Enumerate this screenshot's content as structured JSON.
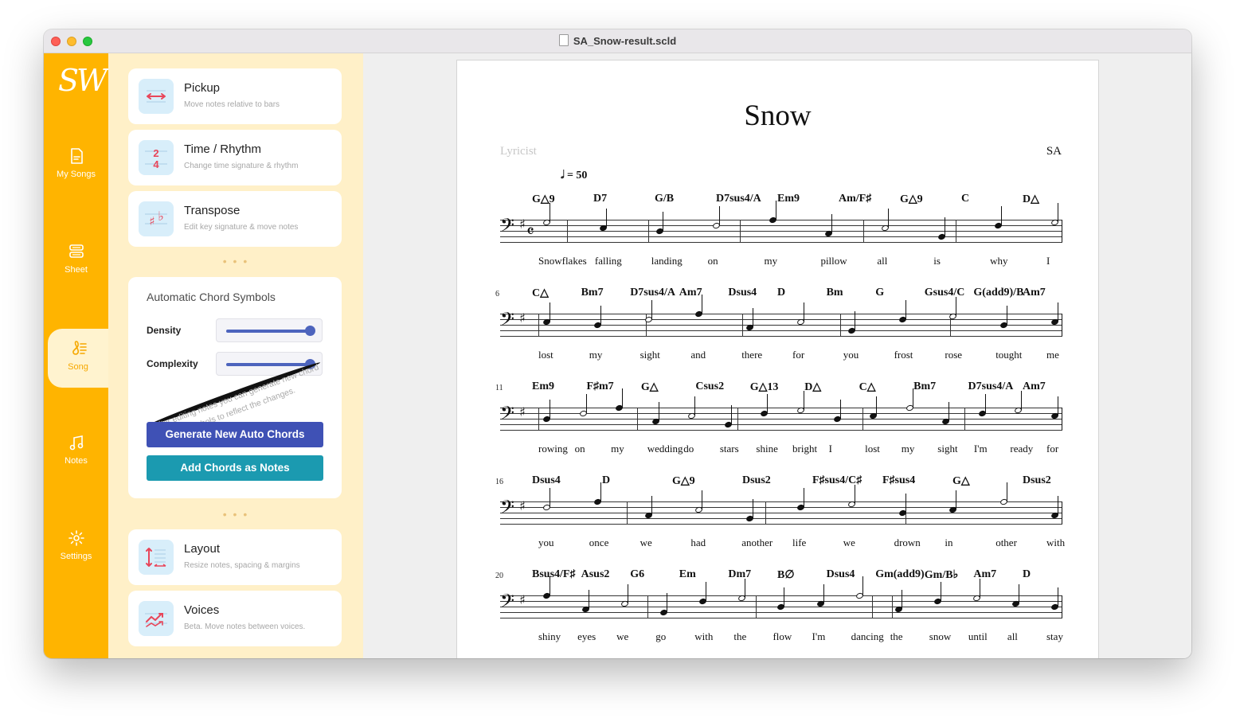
{
  "window": {
    "title": "SA_Snow-result.scld"
  },
  "nav": {
    "logo": "SW",
    "items": [
      {
        "label": "My Songs",
        "icon": "document-icon"
      },
      {
        "label": "Sheet",
        "icon": "sheet-icon"
      },
      {
        "label": "Song",
        "icon": "song-icon",
        "active": true
      },
      {
        "label": "Notes",
        "icon": "music-note-icon"
      },
      {
        "label": "Settings",
        "icon": "gear-icon"
      }
    ]
  },
  "panel": {
    "cards_top": [
      {
        "title": "Pickup",
        "subtitle": "Move notes relative to bars",
        "icon": "pickup-icon"
      },
      {
        "title": "Time / Rhythm",
        "subtitle": "Change time signature & rhythm",
        "icon": "time-signature-icon"
      },
      {
        "title": "Transpose",
        "subtitle": "Edit key signature & move notes",
        "icon": "transpose-icon"
      }
    ],
    "dots": "• • •",
    "auto_chords": {
      "heading": "Automatic Chord Symbols",
      "density_label": "Density",
      "density_value": 1.0,
      "complexity_label": "Complexity",
      "complexity_value": 1.0,
      "note": "After editing notes you can generate new chord symbols to reflect the changes.",
      "generate_button": "Generate New Auto Chords",
      "add_button": "Add Chords as Notes"
    },
    "cards_bottom": [
      {
        "title": "Layout",
        "subtitle": "Resize notes, spacing & margins",
        "icon": "layout-icon"
      },
      {
        "title": "Voices",
        "subtitle": "Beta. Move notes between voices.",
        "icon": "voices-icon"
      }
    ]
  },
  "sheet": {
    "title": "Snow",
    "lyricist": "Lyricist",
    "composer": "SA",
    "tempo": "𝅗𝅥 = 50",
    "clef": "𝄢",
    "key": "♯",
    "time": "𝄴",
    "systems": [
      {
        "measure_number": "",
        "chords": [
          "G△9",
          "D7",
          "G/B",
          "D7sus4/A",
          "Em9",
          "Am/F♯",
          "G△9",
          "C",
          "D△"
        ],
        "lyrics": [
          "Snowflakes",
          "falling",
          "landing",
          "on",
          "my",
          "pillow",
          "all",
          "is",
          "why",
          "I"
        ]
      },
      {
        "measure_number": "6",
        "chords": [
          "C△",
          "Bm7",
          "D7sus4/A",
          "Am7",
          "Dsus4",
          "D",
          "Bm",
          "G",
          "Gsus4/C",
          "G(add9)/B",
          "Am7"
        ],
        "lyrics": [
          "lost",
          "my",
          "sight",
          "and",
          "there",
          "for",
          "you",
          "frost",
          "rose",
          "tought",
          "me"
        ]
      },
      {
        "measure_number": "11",
        "chords": [
          "Em9",
          "F♯m7",
          "G△",
          "Csus2",
          "G△13",
          "D△",
          "C△",
          "Bm7",
          "D7sus4/A",
          "Am7"
        ],
        "lyrics": [
          "rowing",
          "on",
          "my",
          "wedding",
          "do",
          "stars",
          "shine",
          "bright",
          "I",
          "lost",
          "my",
          "sight",
          "I'm",
          "ready",
          "for"
        ]
      },
      {
        "measure_number": "16",
        "chords": [
          "Dsus4",
          "D",
          "G△9",
          "Dsus2",
          "F♯sus4/C♯",
          "F♯sus4",
          "G△",
          "Dsus2"
        ],
        "lyrics": [
          "you",
          "once",
          "we",
          "had",
          "another",
          "life",
          "we",
          "drown",
          "in",
          "other",
          "with"
        ]
      },
      {
        "measure_number": "20",
        "chords": [
          "Bsus4/F♯",
          "Asus2",
          "G6",
          "Em",
          "Dm7",
          "B∅",
          "Dsus4",
          "Gm(add9)",
          "Gm/B♭",
          "Am7",
          "D"
        ],
        "lyrics": [
          "shiny",
          "eyes",
          "we",
          "go",
          "with",
          "the",
          "flow",
          "I'm",
          "dancing",
          "the",
          "snow",
          "until",
          "all",
          "stay"
        ]
      }
    ]
  }
}
